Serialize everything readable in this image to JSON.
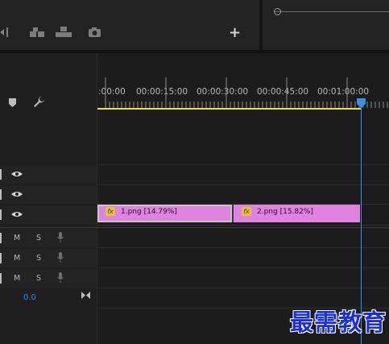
{
  "toolbar": {
    "add_label": "+"
  },
  "timeline": {
    "ruler_labels": [
      ":00:00",
      "00:00:15:00",
      "00:00:30:00",
      "00:00:45:00",
      "00:01:00:00"
    ]
  },
  "tracks": {
    "video": [
      {
        "eye": "eye-icon"
      },
      {
        "eye": "eye-icon"
      },
      {
        "eye": "eye-icon"
      }
    ],
    "audio": [
      {
        "m": "M",
        "s": "S"
      },
      {
        "m": "M",
        "s": "S"
      },
      {
        "m": "M",
        "s": "S"
      }
    ],
    "master_value": "0.0"
  },
  "clips": [
    {
      "fx": "fx",
      "label": "1.png [14.79%]"
    },
    {
      "fx": "fx",
      "label": "2.png [15.82%]"
    }
  ],
  "watermark": {
    "text": "最需教育"
  },
  "colors": {
    "playhead": "#3a8fe8",
    "work_area": "#f1e03a",
    "clip": "#e083e0",
    "master_value": "#2d8ceb"
  }
}
